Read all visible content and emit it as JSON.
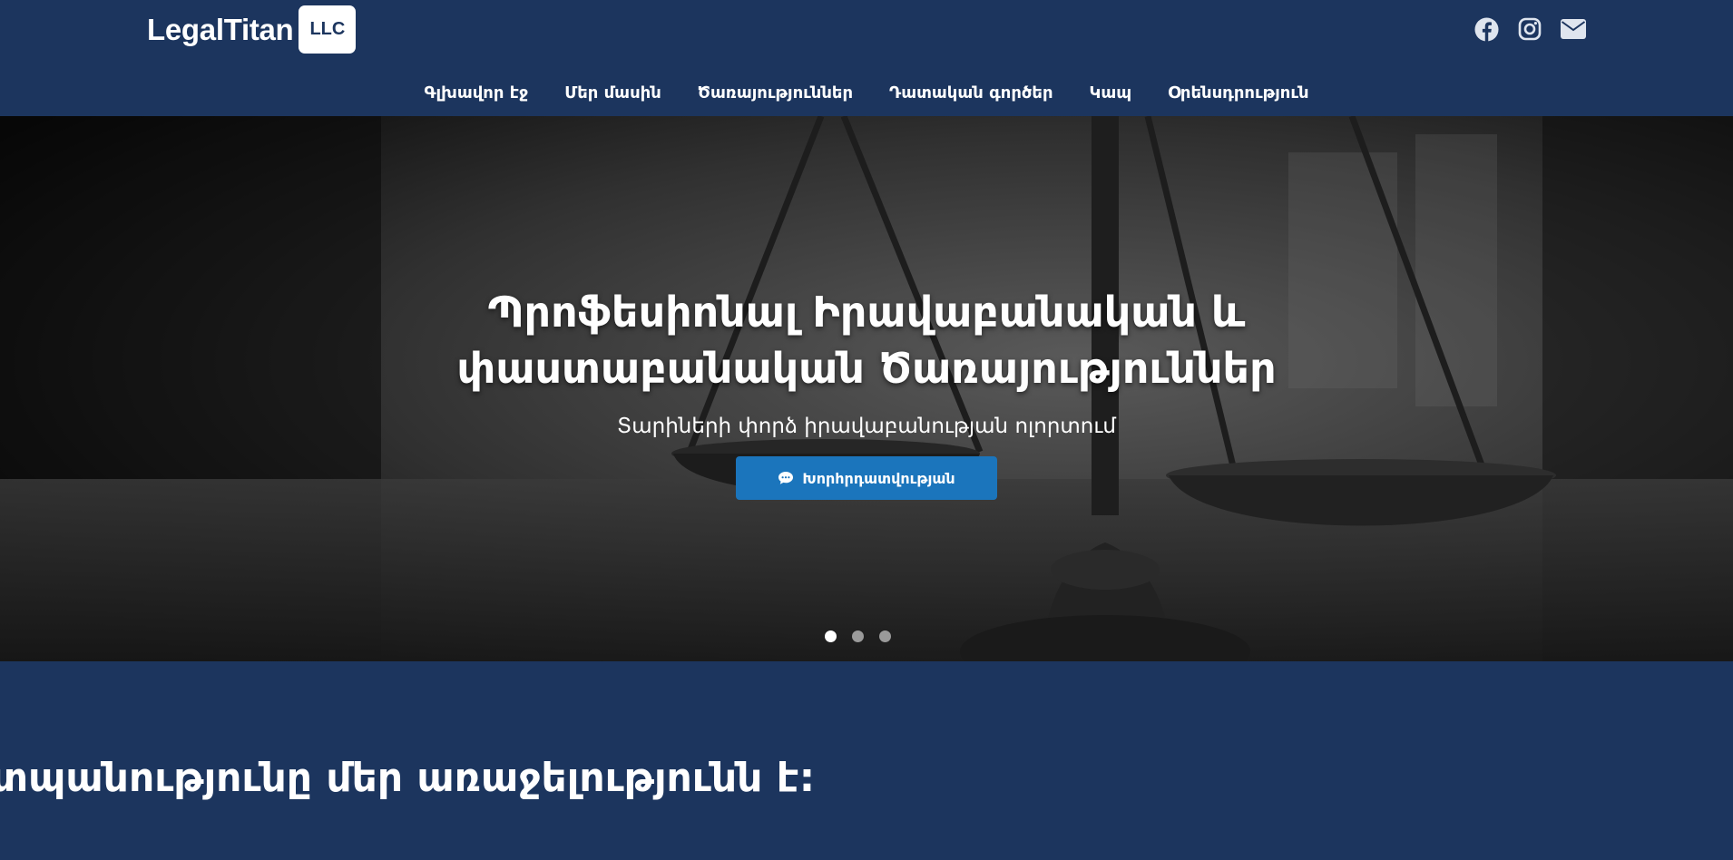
{
  "header": {
    "logo_text": "LegalTitan",
    "logo_badge": "LLC",
    "social_icons": [
      "facebook-icon",
      "instagram-icon",
      "envelope-icon"
    ]
  },
  "nav": {
    "items": [
      {
        "label": "Գլխավոր էջ"
      },
      {
        "label": "Մեր մասին"
      },
      {
        "label": "Ծառայություններ"
      },
      {
        "label": "Դատական գործեր"
      },
      {
        "label": "Կապ"
      },
      {
        "label": "Օրենսդրություն"
      }
    ]
  },
  "hero": {
    "title_line1": "Պրոֆեսիոնալ Իրավաբանական և",
    "title_line2": "փաստաբանական Ծառայություններ",
    "subtitle": "Տարիների փորձ իրավաբանության ոլորտում",
    "cta_label": "Խորհրդատվության",
    "cta_icon": "comment-icon",
    "slides": 3,
    "active_slide": 1
  },
  "section": {
    "title": "տպանությունը մեր առաջելությունն է:"
  },
  "colors": {
    "brand": "#1c355e",
    "cta": "#1b75bc"
  }
}
